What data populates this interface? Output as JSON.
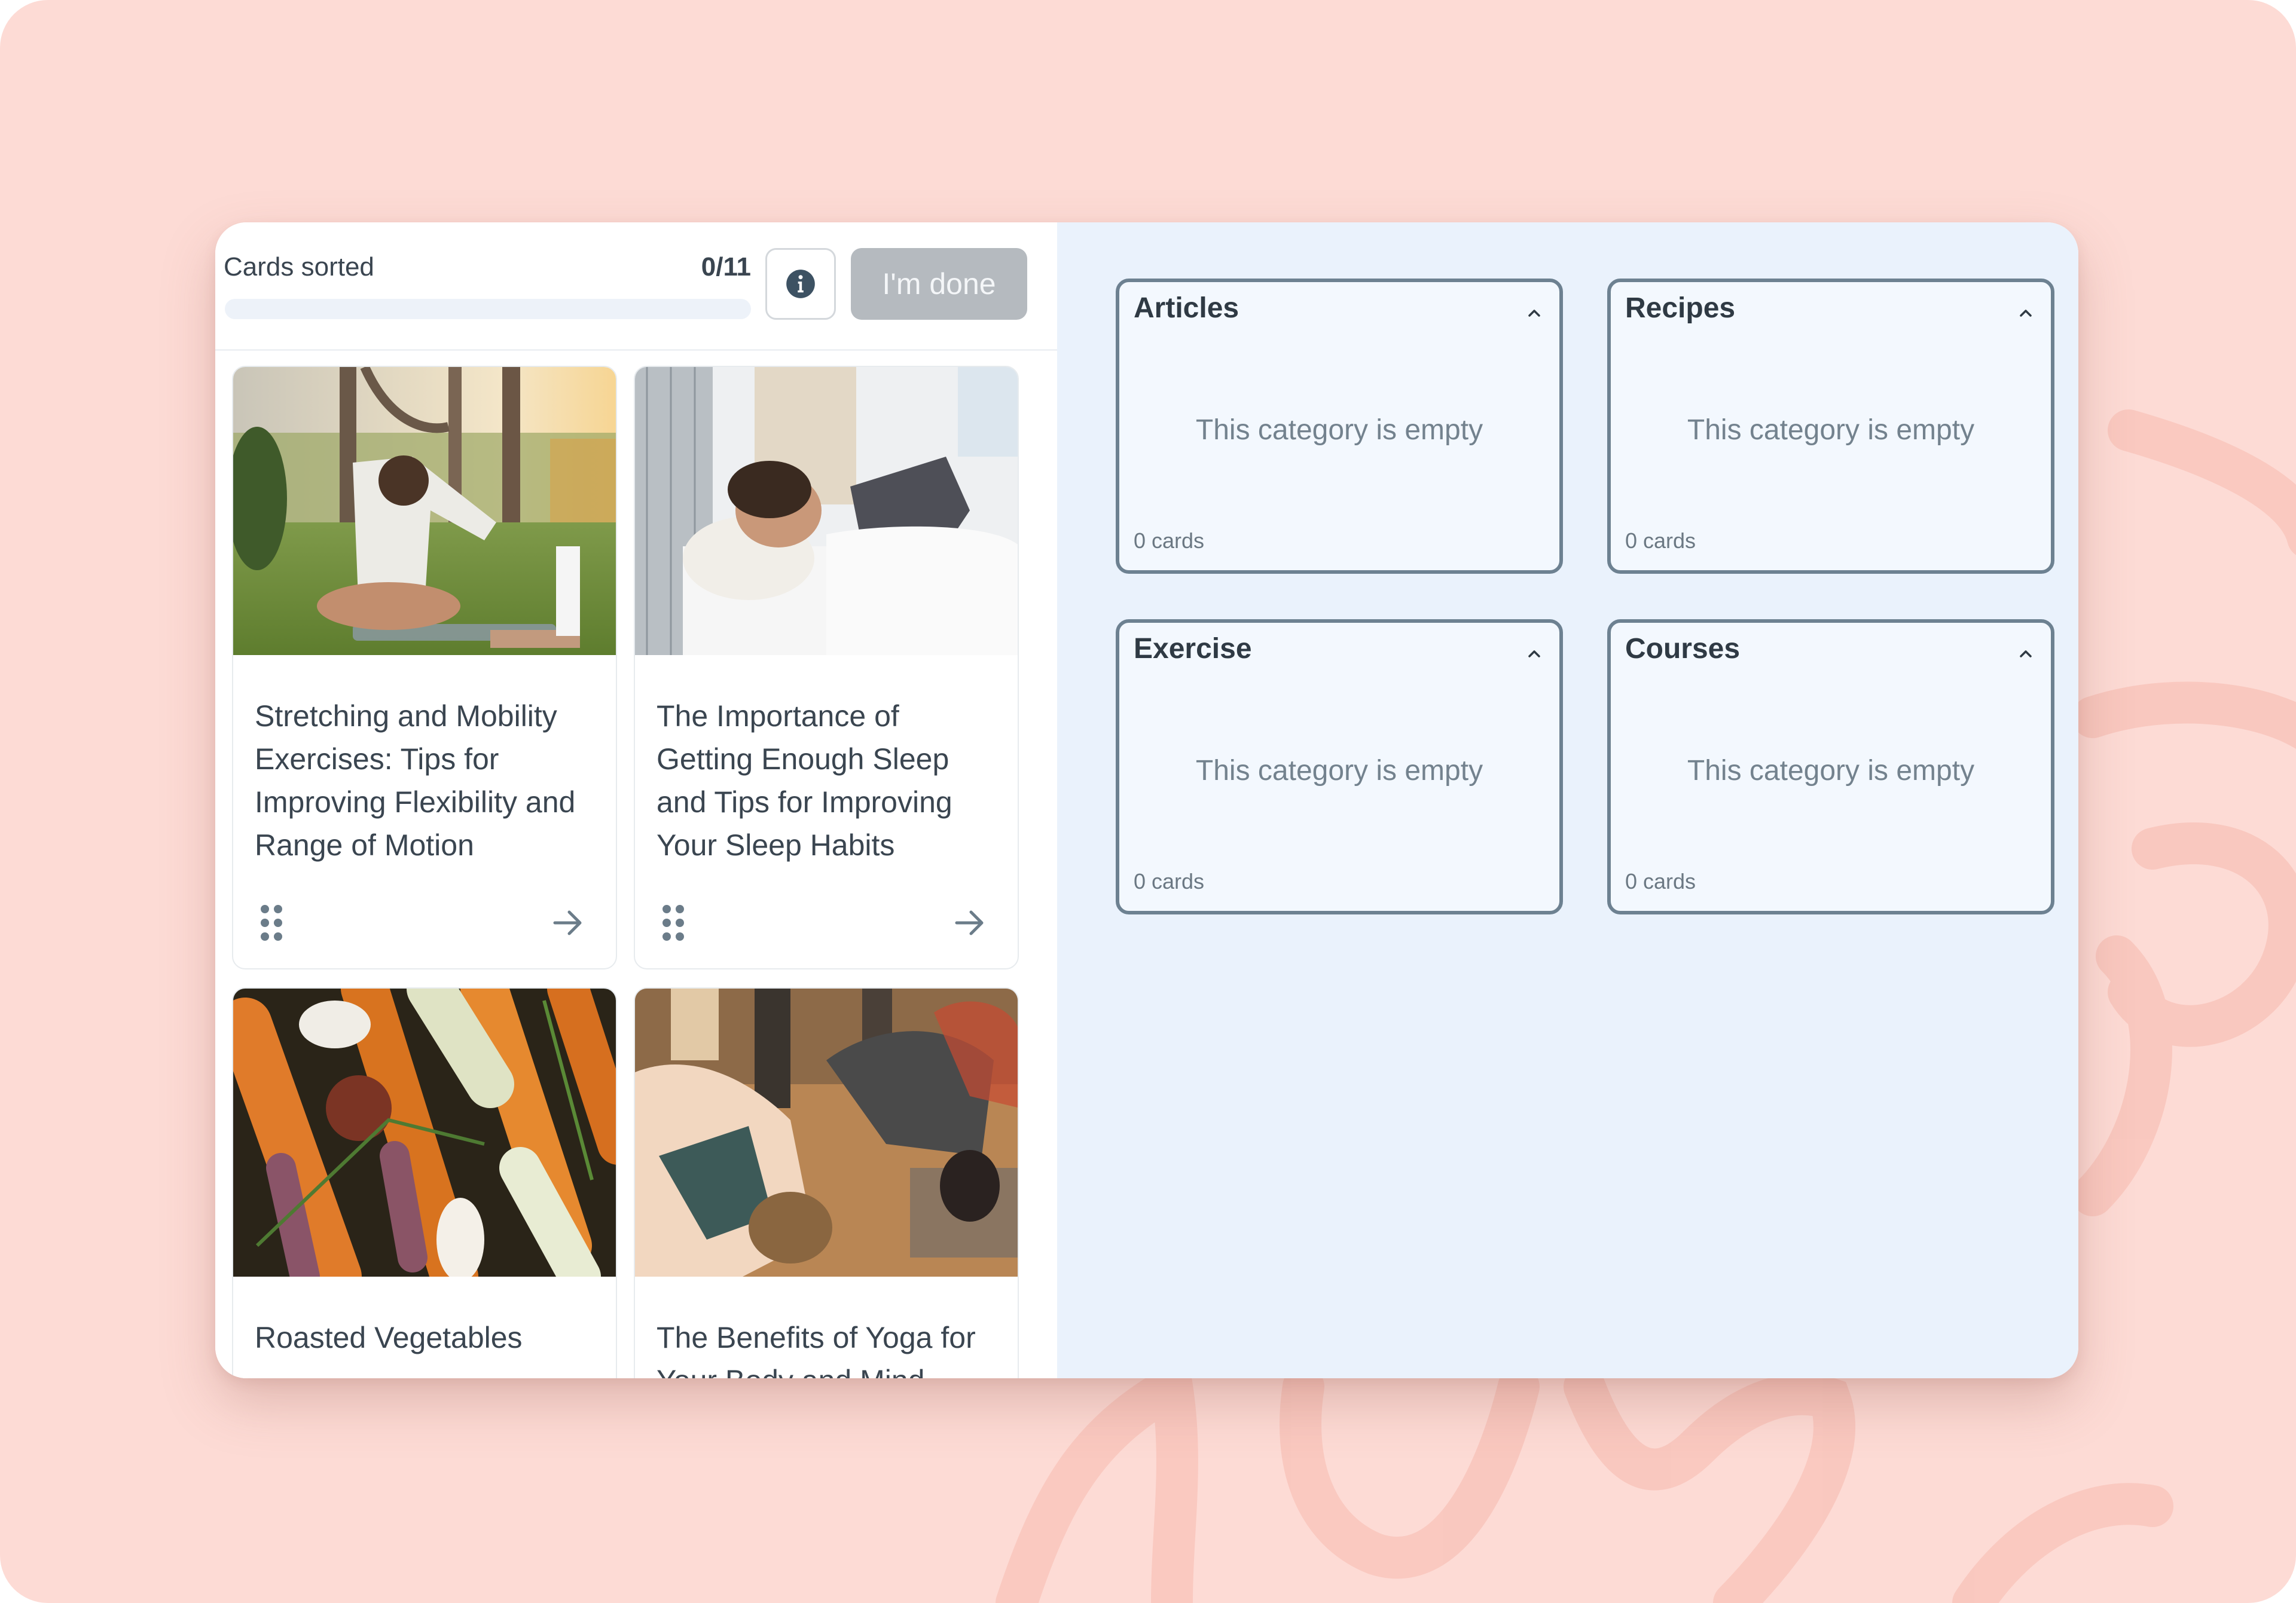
{
  "header": {
    "cards_sorted_label": "Cards sorted",
    "sorted_count": "0/11",
    "progress_fraction": 0.0,
    "info_icon": "info-circle-icon",
    "done_button_label": "I'm done"
  },
  "cards": [
    {
      "title": "Stretching and Mobility Exercises: Tips for Improving Flexibility and Range of Motion",
      "image": "person stretching on grass in park",
      "drag_icon": "drag-handle-icon",
      "action_icon": "arrow-right-icon"
    },
    {
      "title": "The Importance of Getting Enough Sleep and Tips for Improving Your Sleep Habits",
      "image": "man sleeping in bed",
      "drag_icon": "drag-handle-icon",
      "action_icon": "arrow-right-icon"
    },
    {
      "title": "Roasted Vegetables",
      "image": "roasted carrots, onions and rosemary",
      "drag_icon": "drag-handle-icon",
      "action_icon": "arrow-right-icon"
    },
    {
      "title": "The Benefits of Yoga for Your Body and Mind",
      "image": "people in yoga class",
      "drag_icon": "drag-handle-icon",
      "action_icon": "arrow-right-icon"
    }
  ],
  "categories": [
    {
      "name": "Articles",
      "empty_text": "This category is empty",
      "count_text": "0 cards",
      "toggle_icon": "chevron-up-icon"
    },
    {
      "name": "Recipes",
      "empty_text": "This category is empty",
      "count_text": "0 cards",
      "toggle_icon": "chevron-up-icon"
    },
    {
      "name": "Exercise",
      "empty_text": "This category is empty",
      "count_text": "0 cards",
      "toggle_icon": "chevron-up-icon"
    },
    {
      "name": "Courses",
      "empty_text": "This category is empty",
      "count_text": "0 cards",
      "toggle_icon": "chevron-up-icon"
    }
  ],
  "colors": {
    "background": "#fddbd5",
    "squiggle": "#f9c5bc",
    "category_border": "#6d8191",
    "right_pane": "#eaf2fc",
    "done_button_disabled": "#b5babf",
    "text_primary": "#3a4550"
  }
}
